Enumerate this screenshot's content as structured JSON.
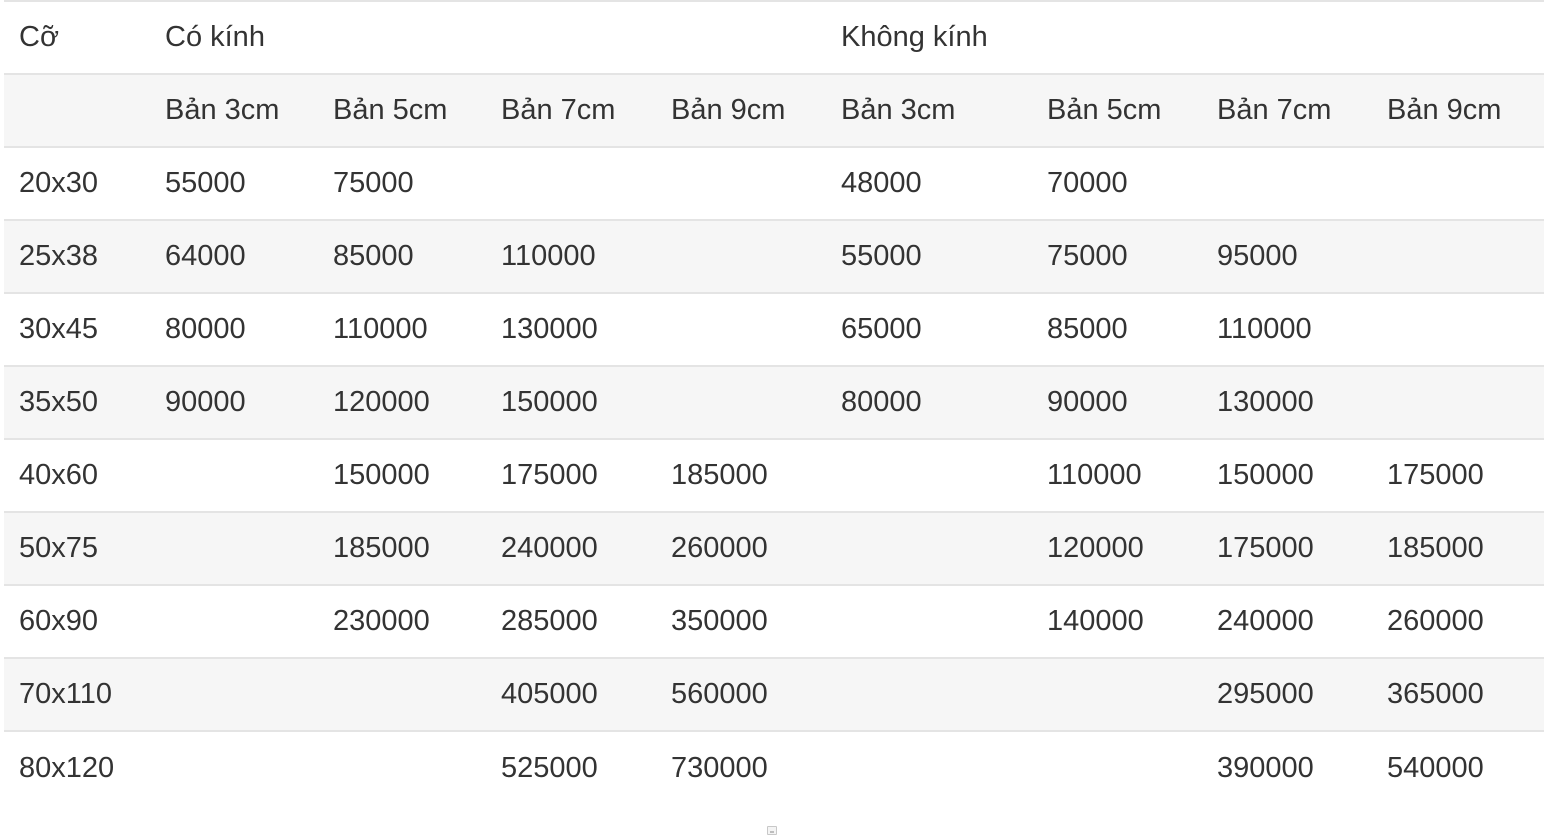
{
  "table": {
    "group_header": {
      "size_label": "Cỡ",
      "with_glass": "Có kính",
      "without_glass": "Không kính"
    },
    "sub_headers": [
      "Bản 3cm",
      "Bản 5cm",
      "Bản 7cm",
      "Bản 9cm",
      "Bản 3cm",
      "Bản 5cm",
      "Bản 7cm",
      "Bản 9cm"
    ],
    "rows": [
      {
        "size": "20x30",
        "cells": [
          "55000",
          "75000",
          "",
          "",
          "48000",
          "70000",
          "",
          ""
        ]
      },
      {
        "size": "25x38",
        "cells": [
          "64000",
          "85000",
          "110000",
          "",
          "55000",
          "75000",
          "95000",
          ""
        ]
      },
      {
        "size": "30x45",
        "cells": [
          "80000",
          "110000",
          "130000",
          "",
          "65000",
          "85000",
          "110000",
          ""
        ]
      },
      {
        "size": "35x50",
        "cells": [
          "90000",
          "120000",
          "150000",
          "",
          "80000",
          "90000",
          "130000",
          ""
        ]
      },
      {
        "size": "40x60",
        "cells": [
          "",
          "150000",
          "175000",
          "185000",
          "",
          "110000",
          "150000",
          "175000"
        ]
      },
      {
        "size": "50x75",
        "cells": [
          "",
          "185000",
          "240000",
          "260000",
          "",
          "120000",
          "175000",
          "185000"
        ]
      },
      {
        "size": "60x90",
        "cells": [
          "",
          "230000",
          "285000",
          "350000",
          "",
          "140000",
          "240000",
          "260000"
        ]
      },
      {
        "size": "70x110",
        "cells": [
          "",
          "",
          "405000",
          "560000",
          "",
          "",
          "295000",
          "365000"
        ]
      },
      {
        "size": "80x120",
        "cells": [
          "",
          "",
          "525000",
          "730000",
          "",
          "",
          "390000",
          "540000"
        ]
      }
    ]
  }
}
